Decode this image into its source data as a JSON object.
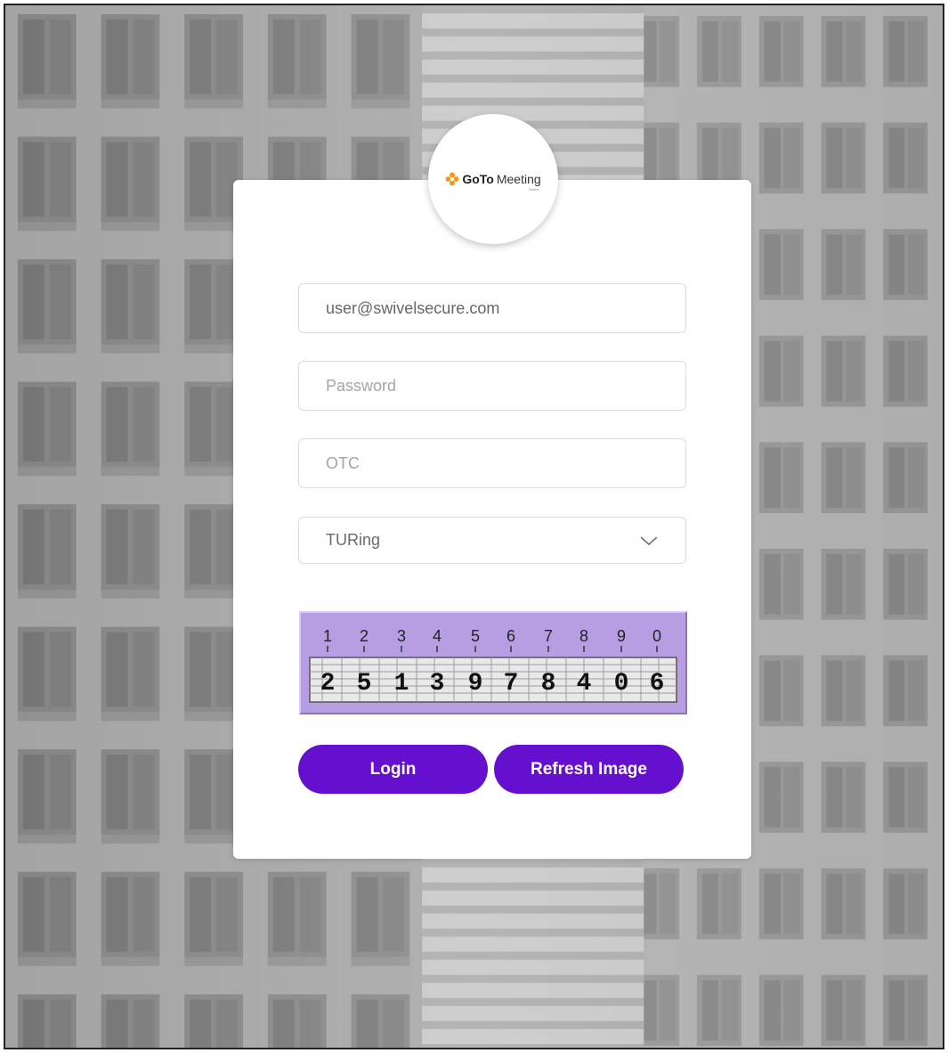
{
  "brand": {
    "logo_bold": "GoTo",
    "logo_regular": "Meeting",
    "logo_sub": "Swivel"
  },
  "form": {
    "username": {
      "value": "user@swivelsecure.com",
      "placeholder": ""
    },
    "password": {
      "value": "",
      "placeholder": "Password"
    },
    "otc": {
      "value": "",
      "placeholder": "OTC"
    },
    "auth_method": {
      "selected": "TURing"
    }
  },
  "captcha": {
    "positions": [
      "1",
      "2",
      "3",
      "4",
      "5",
      "6",
      "7",
      "8",
      "9",
      "0"
    ],
    "digits": [
      "2",
      "5",
      "1",
      "3",
      "9",
      "7",
      "8",
      "4",
      "0",
      "6"
    ]
  },
  "buttons": {
    "login": "Login",
    "refresh": "Refresh Image"
  },
  "colors": {
    "accent": "#6610cf",
    "captcha_bg": "#b79ee3"
  },
  "icons": {
    "select": "chevron-down-icon",
    "logo": "gotomeeting-logo-icon"
  }
}
